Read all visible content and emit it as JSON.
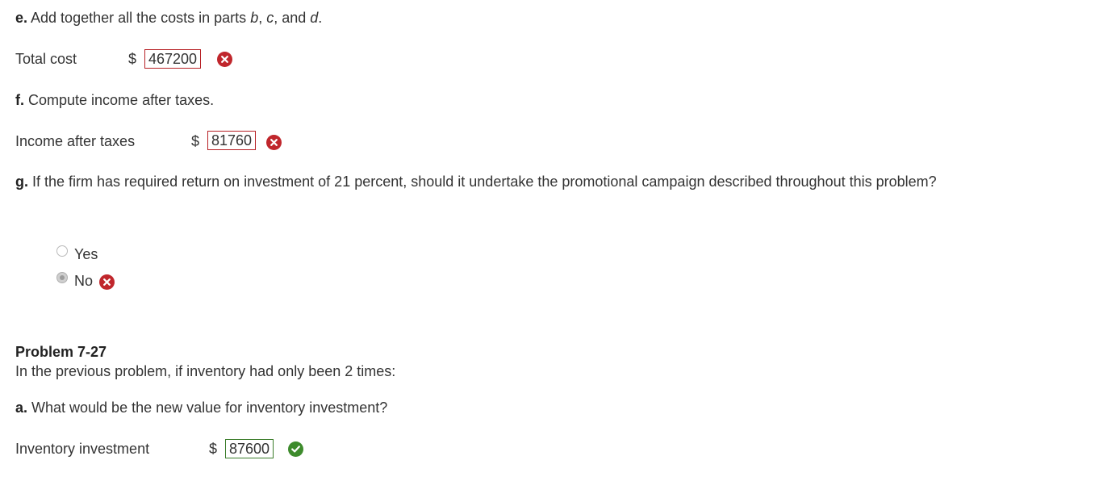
{
  "part_e": {
    "letter": "e.",
    "text_before": " Add together all the costs in parts ",
    "b": "b",
    "sep1": ", ",
    "c": "c",
    "sep2": ", and ",
    "d": "d",
    "end": ".",
    "label": "Total cost",
    "currency": "$",
    "value": "467200",
    "status": "incorrect"
  },
  "part_f": {
    "letter": "f.",
    "text": " Compute income after taxes.",
    "label": "Income after taxes",
    "currency": "$",
    "value": "81760",
    "status": "incorrect"
  },
  "part_g": {
    "letter": "g.",
    "text": " If the firm has required return on investment of 21 percent, should it undertake the promotional campaign described throughout this problem?",
    "options": [
      {
        "label": "Yes",
        "selected": false
      },
      {
        "label": "No",
        "selected": true,
        "status": "incorrect"
      }
    ]
  },
  "problem": {
    "title": "Problem 7-27",
    "intro": "In the previous problem, if inventory had only been 2 times:"
  },
  "part_a": {
    "letter": "a.",
    "text": " What would be the new value for inventory investment?",
    "label": "Inventory investment",
    "currency": "$",
    "value": "87600",
    "status": "correct"
  },
  "colors": {
    "incorrect": "#c0262c",
    "correct": "#3d8b2c",
    "incorrect_border": "#b72025",
    "correct_border": "#3b7c2a"
  },
  "icons": {
    "incorrect": "x-circle-icon",
    "correct": "check-circle-icon"
  }
}
